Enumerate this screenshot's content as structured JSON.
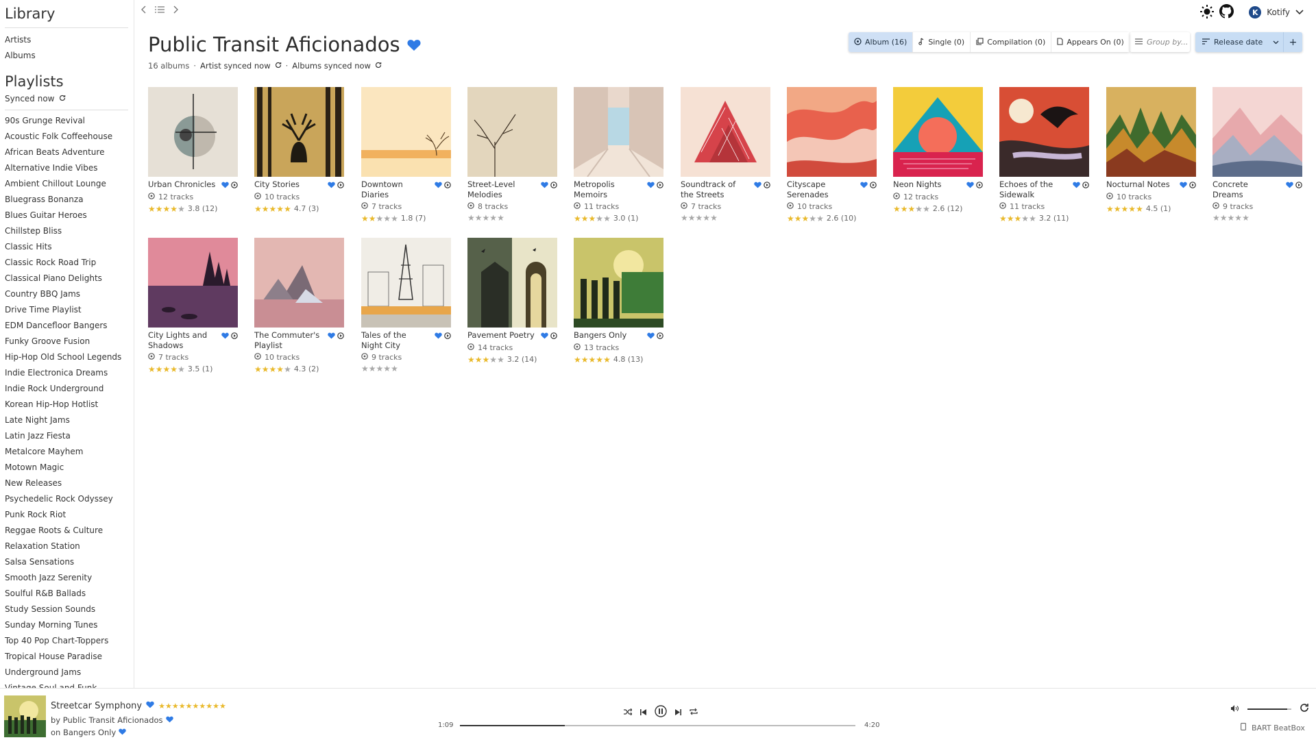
{
  "sidebar": {
    "library_heading": "Library",
    "library_links": [
      "Artists",
      "Albums"
    ],
    "playlists_heading": "Playlists",
    "sync_status": "Synced now",
    "playlists": [
      "90s Grunge Revival",
      "Acoustic Folk Coffeehouse",
      "African Beats Adventure",
      "Alternative Indie Vibes",
      "Ambient Chillout Lounge",
      "Bluegrass Bonanza",
      "Blues Guitar Heroes",
      "Chillstep Bliss",
      "Classic Hits",
      "Classic Rock Road Trip",
      "Classical Piano Delights",
      "Country BBQ Jams",
      "Drive Time Playlist",
      "EDM Dancefloor Bangers",
      "Funky Groove Fusion",
      "Hip-Hop Old School Legends",
      "Indie Electronica Dreams",
      "Indie Rock Underground",
      "Korean Hip-Hop Hotlist",
      "Late Night Jams",
      "Latin Jazz Fiesta",
      "Metalcore Mayhem",
      "Motown Magic",
      "New Releases",
      "Psychedelic Rock Odyssey",
      "Punk Rock Riot",
      "Reggae Roots & Culture",
      "Relaxation Station",
      "Salsa Sensations",
      "Smooth Jazz Serenity",
      "Soulful R&B Ballads",
      "Study Session Sounds",
      "Sunday Morning Tunes",
      "Top 40 Pop Chart-Toppers",
      "Tropical House Paradise",
      "Underground Jams",
      "Vintage Soul and Funk"
    ]
  },
  "topbar": {
    "user_initial": "K",
    "user_name": "Kotify"
  },
  "artist": {
    "name": "Public Transit Aficionados",
    "album_count": "16 albums",
    "artist_sync": "Artist synced now",
    "albums_sync": "Albums synced now"
  },
  "filters": {
    "tabs": [
      "Album (16)",
      "Single (0)",
      "Compilation (0)",
      "Appears On (0)"
    ],
    "group_by_placeholder": "Group by...",
    "sort_label": "Release date"
  },
  "albums": [
    {
      "title": "Urban Chronicles",
      "tracks": "12 tracks",
      "stars": 4,
      "rating": "3.8 (12)"
    },
    {
      "title": "City Stories",
      "tracks": "10 tracks",
      "stars": 5,
      "rating": "4.7 (3)"
    },
    {
      "title": "Downtown Diaries",
      "tracks": "7 tracks",
      "stars": 2,
      "rating": "1.8 (7)"
    },
    {
      "title": "Street-Level Melodies",
      "tracks": "8 tracks",
      "stars": 0,
      "rating": ""
    },
    {
      "title": "Metropolis Memoirs",
      "tracks": "11 tracks",
      "stars": 3,
      "rating": "3.0 (1)"
    },
    {
      "title": "Soundtrack of the Streets",
      "tracks": "7 tracks",
      "stars": 0,
      "rating": ""
    },
    {
      "title": "Cityscape Serenades",
      "tracks": "10 tracks",
      "stars": 3,
      "rating": "2.6 (10)"
    },
    {
      "title": "Neon Nights",
      "tracks": "12 tracks",
      "stars": 3,
      "rating": "2.6 (12)"
    },
    {
      "title": "Echoes of the Sidewalk",
      "tracks": "11 tracks",
      "stars": 3,
      "rating": "3.2 (11)"
    },
    {
      "title": "Nocturnal Notes",
      "tracks": "10 tracks",
      "stars": 5,
      "rating": "4.5 (1)"
    },
    {
      "title": "Concrete Dreams",
      "tracks": "9 tracks",
      "stars": 0,
      "rating": ""
    },
    {
      "title": "City Lights and Shadows",
      "tracks": "7 tracks",
      "stars": 4,
      "rating": "3.5 (1)"
    },
    {
      "title": "The Commuter's Playlist",
      "tracks": "10 tracks",
      "stars": 4,
      "rating": "4.3 (2)"
    },
    {
      "title": "Tales of the Night City",
      "tracks": "9 tracks",
      "stars": 0,
      "rating": ""
    },
    {
      "title": "Pavement Poetry",
      "tracks": "14 tracks",
      "stars": 3,
      "rating": "3.2 (14)"
    },
    {
      "title": "Bangers Only",
      "tracks": "13 tracks",
      "stars": 5,
      "rating": "4.8 (13)"
    }
  ],
  "player": {
    "title": "Streetcar Symphony",
    "stars": 10,
    "artist": "by Public Transit Aficionados",
    "album": "on Bangers Only",
    "current_time": "1:09",
    "duration": "4:20",
    "progress": 0.265,
    "volume": 0.9,
    "device": "BART BeatBox"
  },
  "colors": {
    "accent": "#2f7be5",
    "star": "#e9b92b",
    "active_tab": "#cfe0f5"
  }
}
